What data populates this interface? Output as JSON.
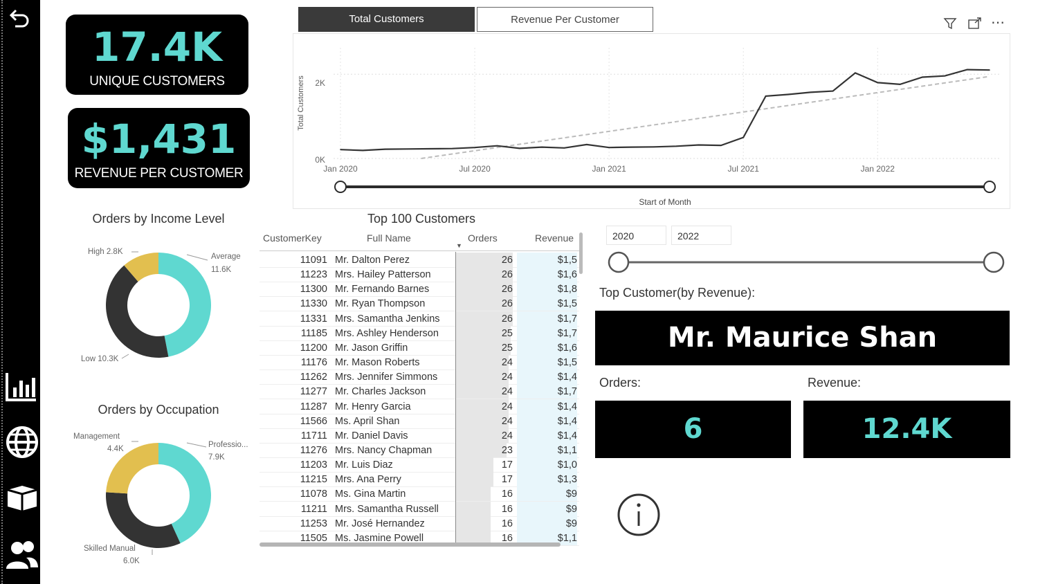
{
  "kpis": {
    "unique_customers": {
      "value": "17.4K",
      "label": "UNIQUE CUSTOMERS"
    },
    "revenue_per_customer": {
      "value": "$1,431",
      "label": "REVENUE PER CUSTOMER"
    }
  },
  "tabs": {
    "total": "Total Customers",
    "revenue": "Revenue Per Customer"
  },
  "line_chart": {
    "ylabel": "Total Customers",
    "xlabel": "Start of Month",
    "yticks": [
      "2K",
      "0K"
    ],
    "xticks": [
      "Jan 2020",
      "Jul 2020",
      "Jan 2021",
      "Jul 2021",
      "Jan 2022"
    ]
  },
  "income_chart": {
    "title": "Orders by Income Level",
    "labels": {
      "high": "High 2.8K",
      "avg_name": "Average",
      "avg_val": "11.6K",
      "low": "Low 10.3K"
    }
  },
  "occupation_chart": {
    "title": "Orders by Occupation",
    "labels": {
      "mgmt_name": "Management",
      "mgmt_val": "4.4K",
      "prof_name": "Professio...",
      "prof_val": "7.9K",
      "skilled_name": "Skilled Manual",
      "skilled_val": "6.0K"
    }
  },
  "table": {
    "title": "Top 100 Customers",
    "headers": {
      "key": "CustomerKey",
      "name": "Full Name",
      "orders": "Orders",
      "revenue": "Revenue"
    },
    "rows": [
      {
        "key": "11091",
        "name": "Mr. Dalton Perez",
        "orders": "26",
        "revenue": "$1,5"
      },
      {
        "key": "11223",
        "name": "Mrs. Hailey Patterson",
        "orders": "26",
        "revenue": "$1,6"
      },
      {
        "key": "11300",
        "name": "Mr. Fernando Barnes",
        "orders": "26",
        "revenue": "$1,8"
      },
      {
        "key": "11330",
        "name": "Mr. Ryan Thompson",
        "orders": "26",
        "revenue": "$1,5"
      },
      {
        "key": "11331",
        "name": "Mrs. Samantha Jenkins",
        "orders": "26",
        "revenue": "$1,7"
      },
      {
        "key": "11185",
        "name": "Mrs. Ashley Henderson",
        "orders": "25",
        "revenue": "$1,7"
      },
      {
        "key": "11200",
        "name": "Mr. Jason Griffin",
        "orders": "25",
        "revenue": "$1,6"
      },
      {
        "key": "11176",
        "name": "Mr. Mason Roberts",
        "orders": "24",
        "revenue": "$1,5"
      },
      {
        "key": "11262",
        "name": "Mrs. Jennifer Simmons",
        "orders": "24",
        "revenue": "$1,4"
      },
      {
        "key": "11277",
        "name": "Mr. Charles Jackson",
        "orders": "24",
        "revenue": "$1,7"
      },
      {
        "key": "11287",
        "name": "Mr. Henry Garcia",
        "orders": "24",
        "revenue": "$1,4"
      },
      {
        "key": "11566",
        "name": "Ms. April Shan",
        "orders": "24",
        "revenue": "$1,4"
      },
      {
        "key": "11711",
        "name": "Mr. Daniel Davis",
        "orders": "24",
        "revenue": "$1,4"
      },
      {
        "key": "11276",
        "name": "Mrs. Nancy Chapman",
        "orders": "23",
        "revenue": "$1,1"
      },
      {
        "key": "11203",
        "name": "Mr. Luis Diaz",
        "orders": "17",
        "revenue": "$1,0"
      },
      {
        "key": "11215",
        "name": "Mrs. Ana Perry",
        "orders": "17",
        "revenue": "$1,3"
      },
      {
        "key": "11078",
        "name": "Ms. Gina Martin",
        "orders": "16",
        "revenue": "$9"
      },
      {
        "key": "11211",
        "name": "Mrs. Samantha Russell",
        "orders": "16",
        "revenue": "$9"
      },
      {
        "key": "11253",
        "name": "Mr. José Hernandez",
        "orders": "16",
        "revenue": "$9"
      },
      {
        "key": "11505",
        "name": "Ms. Jasmine Powell",
        "orders": "16",
        "revenue": "$1,1"
      }
    ]
  },
  "year_slicer": {
    "start": "2020",
    "end": "2022"
  },
  "top_customer": {
    "heading": "Top Customer(by Revenue):",
    "name": "Mr. Maurice Shan",
    "orders_label": "Orders:",
    "revenue_label": "Revenue:",
    "orders_value": "6",
    "revenue_value": "12.4K"
  },
  "colors": {
    "teal": "#5fd8d0",
    "dark": "#333333",
    "gold": "#e2bf4f"
  },
  "chart_data": [
    {
      "type": "line",
      "ylabel": "Total Customers",
      "xlabel": "Start of Month",
      "x": [
        "Jan 2020",
        "Feb 2020",
        "Mar 2020",
        "Apr 2020",
        "May 2020",
        "Jun 2020",
        "Jul 2020",
        "Aug 2020",
        "Sep 2020",
        "Oct 2020",
        "Nov 2020",
        "Dec 2020",
        "Jan 2021",
        "Feb 2021",
        "Mar 2021",
        "Apr 2021",
        "May 2021",
        "Jun 2021",
        "Jul 2021",
        "Aug 2021",
        "Sep 2021",
        "Oct 2021",
        "Nov 2021",
        "Dec 2021",
        "Jan 2022",
        "Feb 2022",
        "Mar 2022",
        "Apr 2022",
        "May 2022",
        "Jun 2022"
      ],
      "series": [
        {
          "values": [
            210,
            190,
            220,
            225,
            230,
            235,
            260,
            300,
            240,
            270,
            250,
            330,
            260,
            270,
            275,
            290,
            320,
            310,
            500,
            1480,
            1520,
            1570,
            1600,
            2030,
            1800,
            1760,
            1930,
            1960,
            2110,
            2100
          ]
        }
      ],
      "trendline": true,
      "ylim": [
        0,
        2300
      ],
      "yticks": [
        0,
        2000
      ]
    },
    {
      "type": "pie",
      "title": "Orders by Income Level",
      "categories": [
        "Average",
        "Low",
        "High"
      ],
      "values": [
        11.6,
        10.3,
        2.8
      ]
    },
    {
      "type": "pie",
      "title": "Orders by Occupation",
      "categories": [
        "Professio...",
        "Skilled Manual",
        "Management"
      ],
      "values": [
        7.9,
        6.0,
        4.4
      ]
    }
  ]
}
